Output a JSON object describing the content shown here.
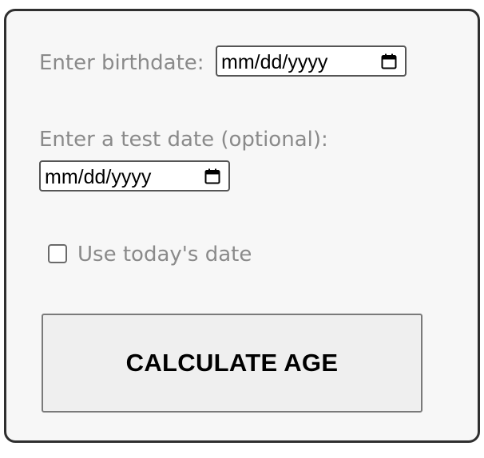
{
  "form": {
    "birthdate_label": "Enter birthdate:",
    "birthdate_placeholder": "mm/dd/yyyy",
    "test_date_label": "Enter a test date (optional):",
    "test_date_placeholder": "mm/dd/yyyy",
    "use_today_label": "Use today's date",
    "use_today_checked": false,
    "calculate_button_label": "CALCULATE AGE"
  },
  "icons": {
    "calendar": "calendar-icon"
  },
  "colors": {
    "card_background": "#f7f7f7",
    "card_border": "#2f2f2f",
    "label_text": "#8a8a8a",
    "button_background": "#efefef"
  }
}
